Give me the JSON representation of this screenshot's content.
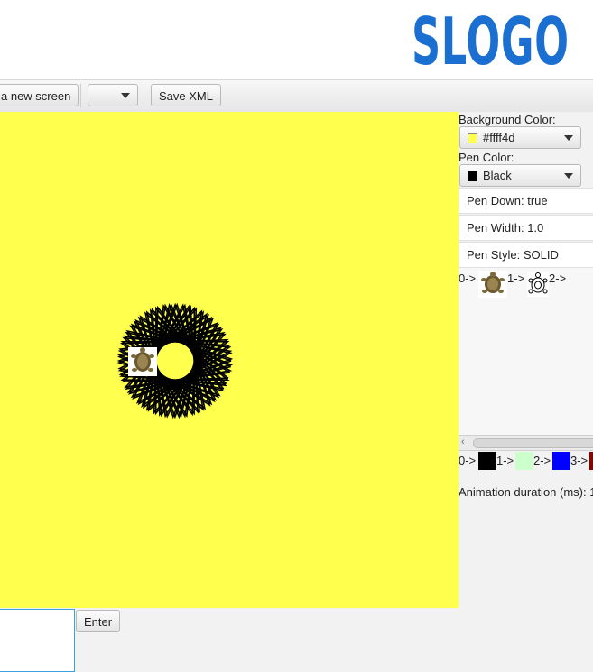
{
  "header": {
    "logo": "SLOGO"
  },
  "toolbar": {
    "new_screen_label": "a new screen",
    "dropdown_value": "",
    "save_xml_label": "Save XML"
  },
  "panel": {
    "background_label": "Background Color:",
    "background_value": "#ffff4d",
    "pen_color_label": "Pen Color:",
    "pen_color_value": "Black",
    "pen_down": "Pen Down: true",
    "pen_width": "Pen Width: 1.0",
    "pen_style": "Pen Style: SOLID",
    "turtle_images": [
      {
        "index": "0->",
        "icon": "turtle-photo-icon"
      },
      {
        "index": "1->",
        "icon": "turtle-outline-icon"
      },
      {
        "index": "2->",
        "icon": ""
      }
    ],
    "palette": [
      {
        "index": "0->",
        "color": "#000000"
      },
      {
        "index": "1->",
        "color": "#ccffcc"
      },
      {
        "index": "2->",
        "color": "#0000ff"
      },
      {
        "index": "3->",
        "color": "#8b0000"
      }
    ],
    "animation_label": "Animation duration (ms): 1"
  },
  "canvas": {
    "background": "#ffff4d",
    "pen_color": "#000000"
  },
  "command": {
    "value": "",
    "enter_label": "Enter"
  }
}
